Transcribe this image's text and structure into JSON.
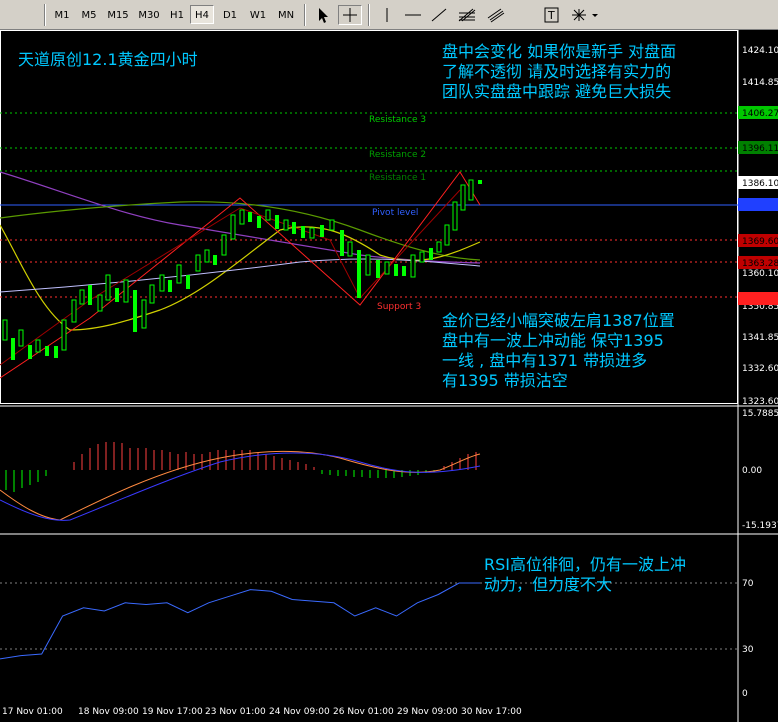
{
  "toolbar": {
    "timeframes": [
      "M1",
      "M5",
      "M15",
      "M30",
      "H1",
      "H4",
      "D1",
      "W1",
      "MN"
    ],
    "active_timeframe": "H4"
  },
  "annotations": {
    "title": "天道原创12.1黄金四小时",
    "warning": [
      "盘中会变化 如果你是新手 对盘面",
      "了解不透彻 请及时选择有实力的",
      "团队实盘盘中跟踪 避免巨大损失"
    ],
    "analysis": [
      "金价已经小幅突破左肩1387位置",
      "盘中有一波上冲动能 保守1395",
      "一线 , 盘中有1371 带损进多",
      "有1395 带损沽空"
    ],
    "rsi_note": [
      "RSI高位徘徊，仍有一波上冲",
      "动力，但力度不大"
    ]
  },
  "levels": {
    "resistance3": "Resistance 3",
    "resistance2": "Resistance 2",
    "resistance1": "Resistance 1",
    "pivot": "Pivot level",
    "support3": "Support 3"
  },
  "price_axis": [
    "1424.10",
    "1414.85",
    "1406.27",
    "1396.11",
    "1386.10",
    "1378.94",
    "1369.60",
    "1363.28",
    "1360.10",
    "1350.85",
    "1341.85",
    "1332.60",
    "1323.60"
  ],
  "macd_axis": [
    "15.7885",
    "0.00",
    "-15.1937"
  ],
  "rsi_axis": [
    "70",
    "30",
    "0"
  ],
  "time_axis": [
    "17 Nov 01:00",
    "18 Nov 09:00",
    "19 Nov 17:00",
    "23 Nov 01:00",
    "24 Nov 09:00",
    "26 Nov 01:00",
    "29 Nov 09:00",
    "30 Nov 17:00"
  ],
  "chart_data": {
    "type": "line",
    "series": [
      {
        "values": [
          1346,
          1340,
          1337,
          1343,
          1352,
          1360,
          1368,
          1371,
          1380,
          1374,
          1376,
          1382,
          1378,
          1375,
          1372,
          1369,
          1366,
          1366,
          1368,
          1372,
          1378,
          1385,
          1390
        ]
      }
    ],
    "rsi_values": [
      24,
      26,
      27,
      50,
      55,
      53,
      58,
      57,
      58,
      52,
      58,
      62,
      66,
      65,
      60,
      59,
      58,
      50,
      55,
      50,
      58,
      63,
      70,
      70
    ],
    "ylim": [
      1323.6,
      1424.1
    ]
  },
  "colors": {
    "background": "#000000",
    "text_cyan": "#00c8ff",
    "resistance": "#00c800",
    "support": "#ff3030",
    "pivot": "#3060ff"
  }
}
